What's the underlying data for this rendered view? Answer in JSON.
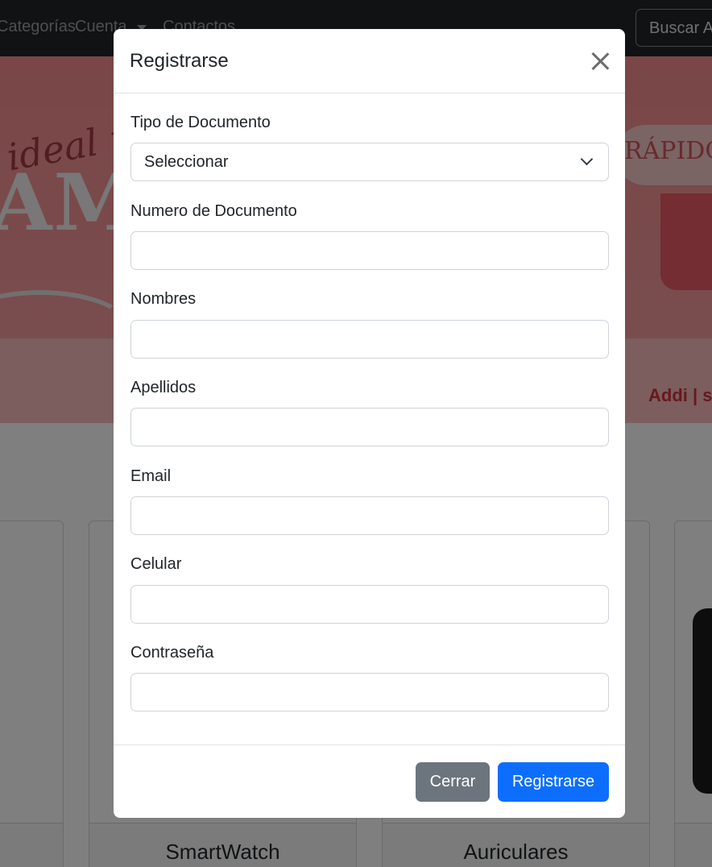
{
  "navbar": {
    "items": [
      {
        "label": "Categorías"
      },
      {
        "label": "Cuenta"
      },
      {
        "label": "Contactos"
      }
    ],
    "search_label": "Buscar A"
  },
  "hero": {
    "script_text": "ideal p",
    "big_text": "AM",
    "badge_text": "RÁPIDO",
    "brand_text": "Addi | s"
  },
  "products": {
    "cards": [
      {
        "title": "SmartWatch"
      },
      {
        "title": "Auriculares"
      }
    ]
  },
  "modal": {
    "title": "Registrarse",
    "fields": [
      {
        "label": "Tipo de Documento",
        "type": "select",
        "value": "Seleccionar",
        "placeholder": ""
      },
      {
        "label": "Numero de Documento",
        "type": "text",
        "value": "",
        "placeholder": ""
      },
      {
        "label": "Nombres",
        "type": "text",
        "value": "",
        "placeholder": ""
      },
      {
        "label": "Apellidos",
        "type": "text",
        "value": "",
        "placeholder": ""
      },
      {
        "label": "Email",
        "type": "email",
        "value": "",
        "placeholder": ""
      },
      {
        "label": "Celular",
        "type": "text",
        "value": "",
        "placeholder": ""
      },
      {
        "label": "Contraseña",
        "type": "password",
        "value": "",
        "placeholder": ""
      }
    ],
    "buttons": {
      "close_label": "Cerrar",
      "submit_label": "Registrarse"
    }
  },
  "colors": {
    "navbar_bg": "#212529",
    "primary": "#0d6efd",
    "secondary": "#6c757d",
    "hero_pink": "#f48d8f"
  }
}
